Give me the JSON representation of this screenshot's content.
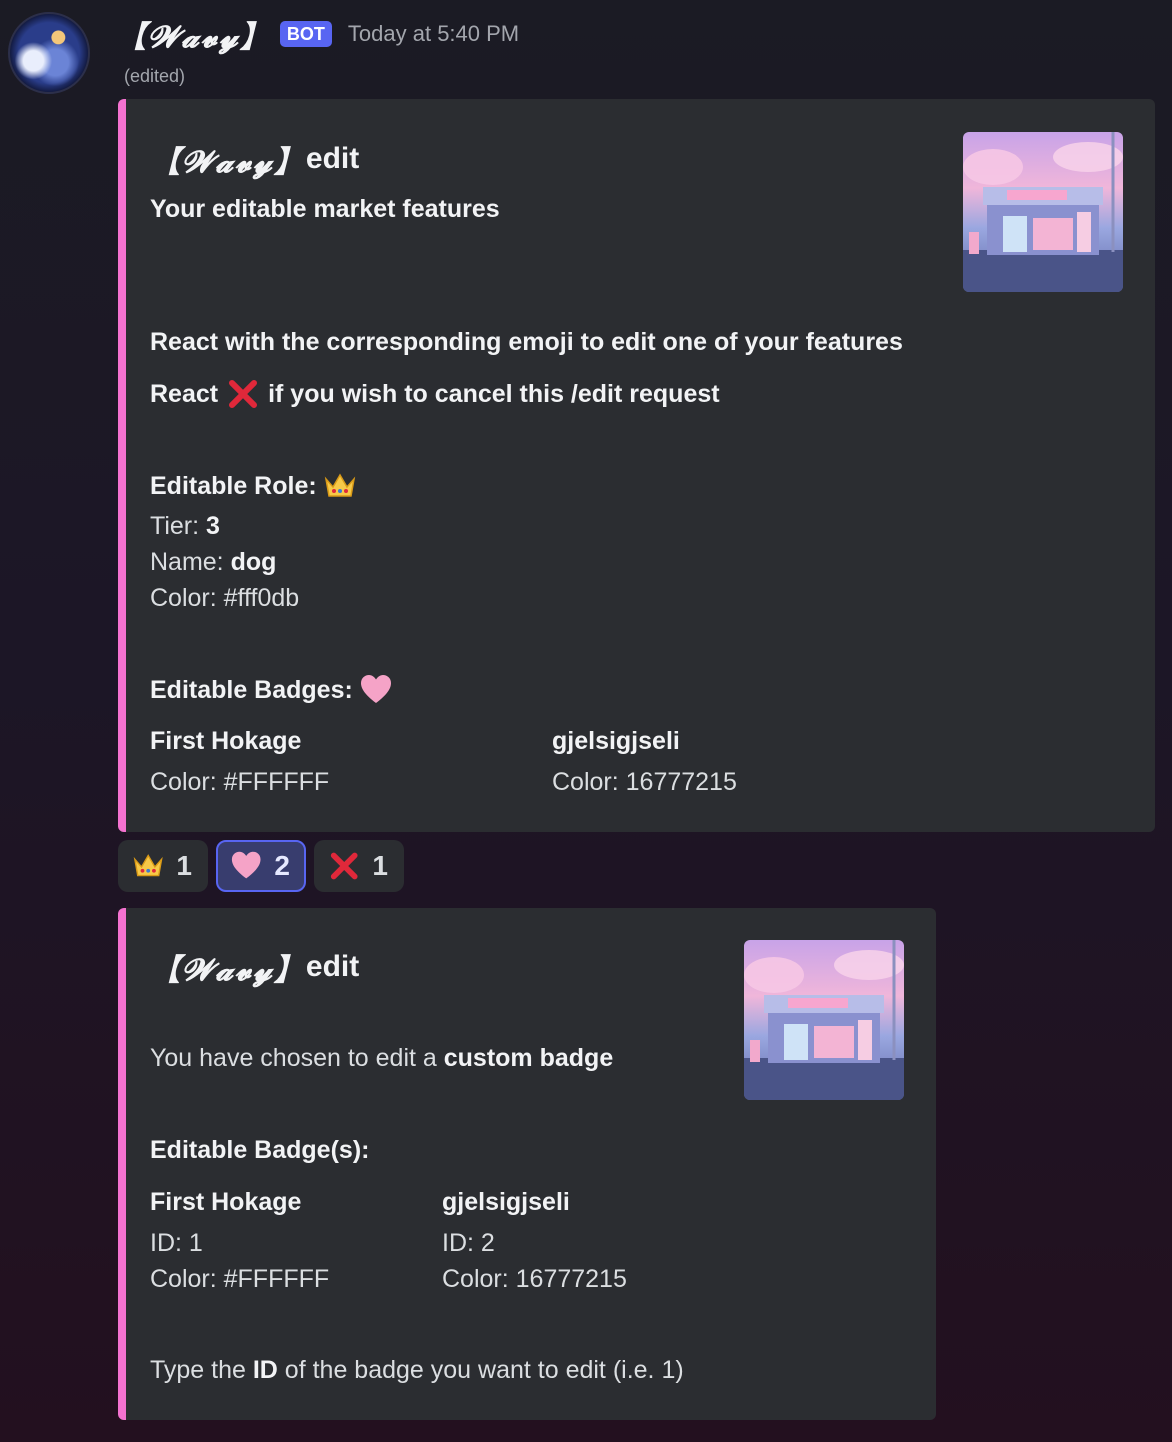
{
  "message": {
    "author": "【𝓦𝓪𝓿𝔂】",
    "bot_tag": "BOT",
    "timestamp": "Today at 5:40 PM",
    "edited": "(edited)"
  },
  "embed1": {
    "title_fancy": "【𝓦𝓪𝓿𝔂】",
    "title_suffix": "edit",
    "subtitle": "Your editable market features",
    "instruction": "React with the corresponding emoji to edit one of your features",
    "cancel_prefix": "React",
    "cancel_suffix": "if you wish to cancel this /edit request",
    "role_heading": "Editable Role:",
    "tier_label": "Tier: ",
    "tier_value": "3",
    "name_label": "Name: ",
    "name_value": "dog",
    "color_line": "Color: #fff0db",
    "badges_heading": "Editable Badges:",
    "badges": [
      {
        "name": "First Hokage",
        "color": "Color: #FFFFFF"
      },
      {
        "name": "gjelsigjseli",
        "color": "Color: 16777215"
      }
    ]
  },
  "reactions": [
    {
      "icon": "crown-icon",
      "count": "1",
      "active": false
    },
    {
      "icon": "pink-heart-icon",
      "count": "2",
      "active": true
    },
    {
      "icon": "cross-mark-icon",
      "count": "1",
      "active": false
    }
  ],
  "embed2": {
    "title_fancy": "【𝓦𝓪𝓿𝔂】",
    "title_suffix": "edit",
    "chosen_prefix": "You have chosen to edit a ",
    "chosen_bold": "custom badge",
    "badges_heading": "Editable Badge(s):",
    "badges": [
      {
        "name": "First Hokage",
        "id": "ID: 1",
        "color": "Color: #FFFFFF"
      },
      {
        "name": "gjelsigjseli",
        "id": "ID: 2",
        "color": "Color: 16777215"
      }
    ],
    "prompt_prefix": "Type the ",
    "prompt_bold": "ID",
    "prompt_suffix": " of the badge you want to edit (i.e. 1)"
  },
  "colors": {
    "embed_accent": "#f472d0",
    "bot_tag": "#5865f2",
    "embed_bg": "#2b2d31"
  }
}
